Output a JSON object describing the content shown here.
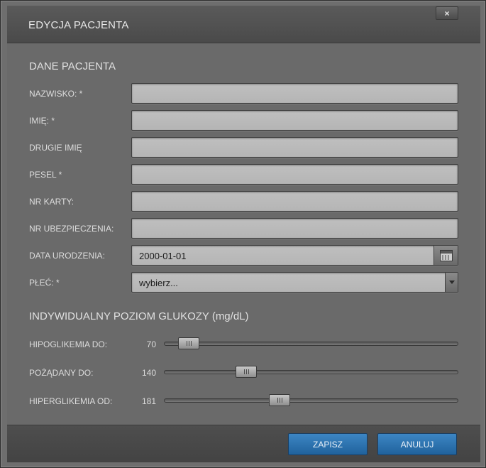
{
  "dialog": {
    "title": "EDYCJA PACJENTA",
    "close_label": "×"
  },
  "patient": {
    "section_title": "DANE PACJENTA",
    "fields": [
      {
        "label": "NAZWISKO: *",
        "value": ""
      },
      {
        "label": "IMIĘ: *",
        "value": ""
      },
      {
        "label": "DRUGIE IMIĘ",
        "value": ""
      },
      {
        "label": "PESEL *",
        "value": ""
      },
      {
        "label": "NR KARTY:",
        "value": ""
      },
      {
        "label": "NR UBEZPIECZENIA:",
        "value": ""
      }
    ],
    "birth_date": {
      "label": "DATA URODZENIA:",
      "value": "2000-01-01"
    },
    "sex": {
      "label": "PŁEĆ: *",
      "value": "wybierz..."
    }
  },
  "glucose": {
    "section_title": "INDYWIDUALNY POZIOM GLUKOZY (mg/dL)",
    "slider_min": 40,
    "slider_max": 400,
    "sliders": [
      {
        "label": "HIPOGLIKEMIA DO:",
        "value": "70"
      },
      {
        "label": "POŻĄDANY DO:",
        "value": "140"
      },
      {
        "label": "HIPERGLIKEMIA OD:",
        "value": "181"
      }
    ]
  },
  "footer": {
    "save_label": "ZAPISZ",
    "cancel_label": "ANULUJ"
  },
  "colors": {
    "accent_button": "#2a6fae",
    "panel": "#6a6a6a",
    "header": "#4f4f4f"
  }
}
